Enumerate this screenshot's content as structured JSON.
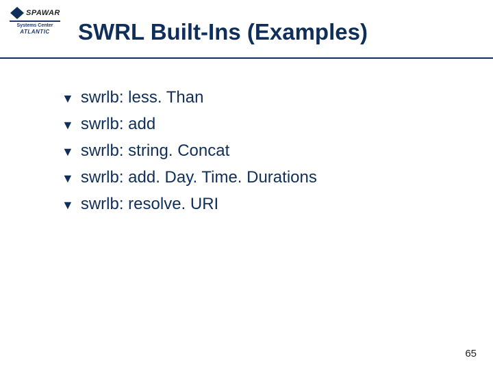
{
  "logo": {
    "word": "SPAWAR",
    "sub_line1": "Systems Center",
    "sub_line2": "ATLANTIC"
  },
  "title": "SWRL Built-Ins (Examples)",
  "bullets": [
    "swrlb: less. Than",
    "swrlb: add",
    "swrlb: string. Concat",
    "swrlb: add. Day. Time. Durations",
    "swrlb: resolve. URI"
  ],
  "page_number": "65"
}
